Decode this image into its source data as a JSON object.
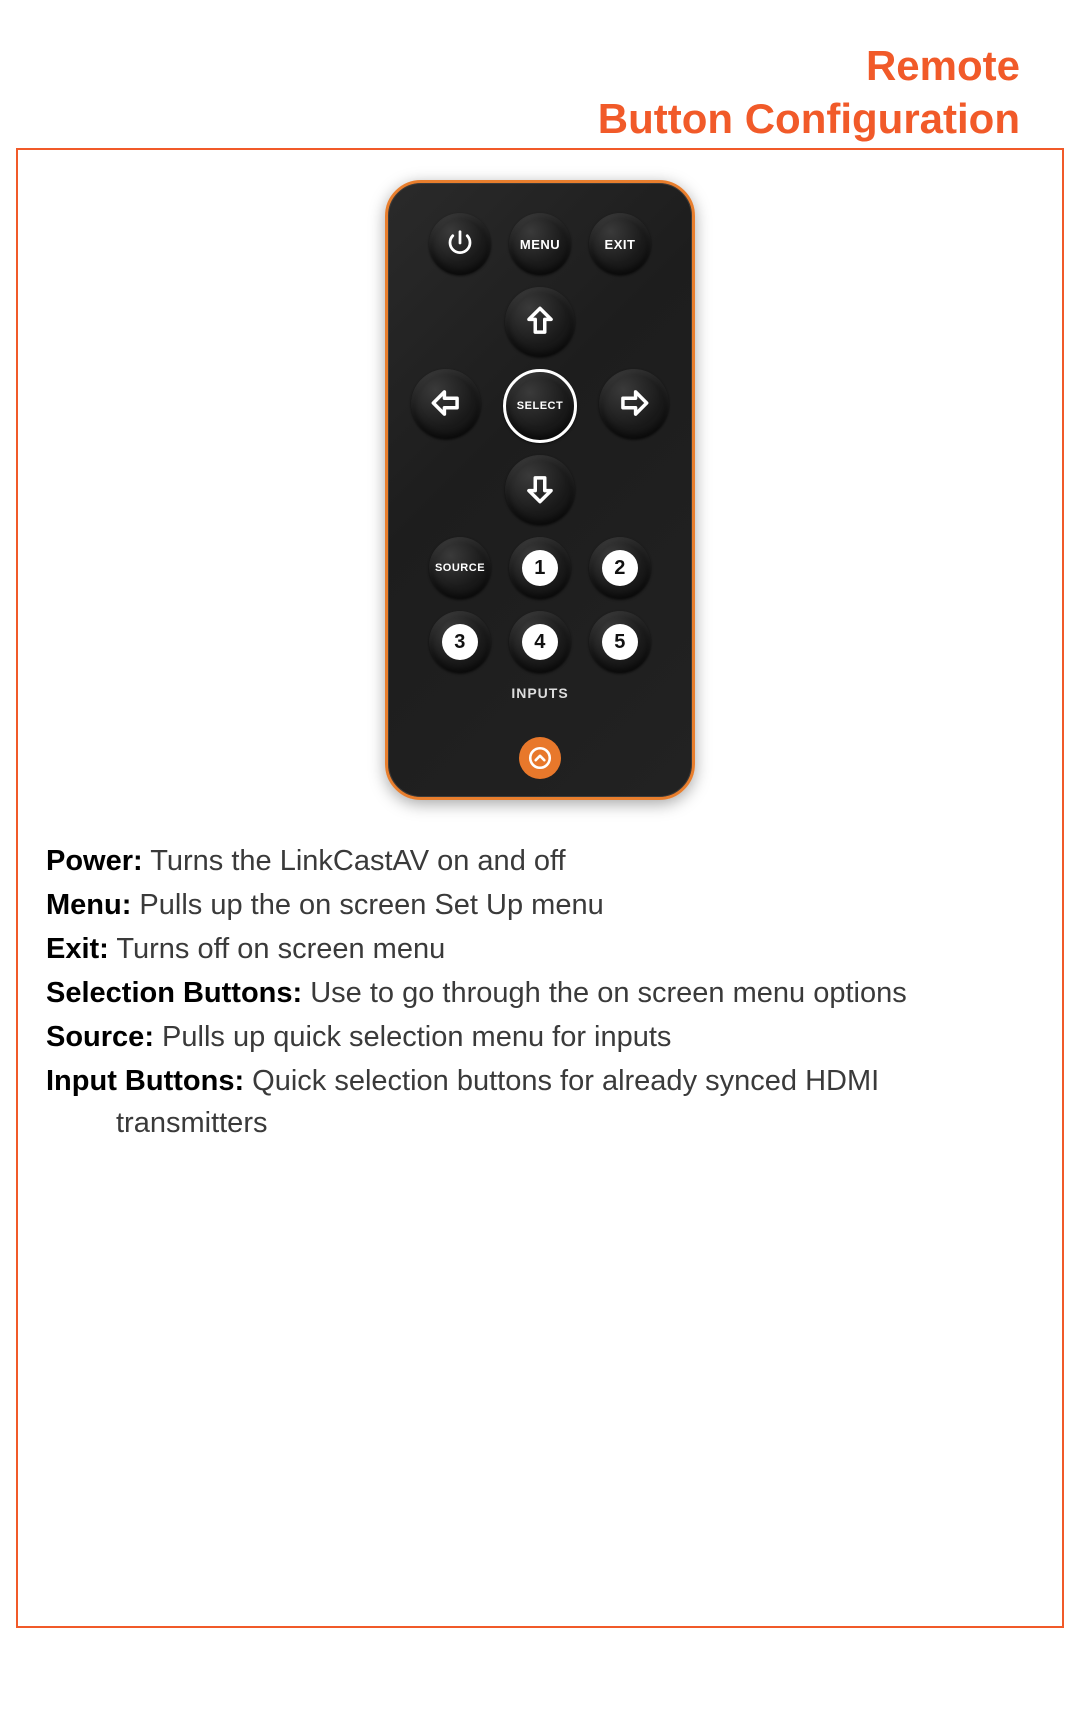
{
  "header": {
    "line1": "Remote",
    "line2": "Button Configuration"
  },
  "remote": {
    "buttons": {
      "power": "power-icon",
      "menu": "MENU",
      "exit": "EXIT",
      "up": "arrow-up-icon",
      "down": "arrow-down-icon",
      "left": "arrow-left-icon",
      "right": "arrow-right-icon",
      "select": "SELECT",
      "source": "SOURCE",
      "inputs_label": "INPUTS",
      "numbers": [
        "1",
        "2",
        "3",
        "4",
        "5"
      ]
    },
    "logo": "brand-logo-icon"
  },
  "descriptions": [
    {
      "label": "Power:",
      "text": " Turns the LinkCastAV on and off"
    },
    {
      "label": "Menu:",
      "text": " Pulls up the on screen Set Up menu"
    },
    {
      "label": "Exit:",
      "text": " Turns off on screen menu"
    },
    {
      "label": "Selection Buttons:",
      "text": " Use to go through the on screen menu options"
    },
    {
      "label": "Source:",
      "text": " Pulls up quick selection menu for inputs"
    },
    {
      "label": "Input Buttons:",
      "text": " Quick selection buttons for already synced HDMI",
      "cont": "transmitters"
    }
  ]
}
